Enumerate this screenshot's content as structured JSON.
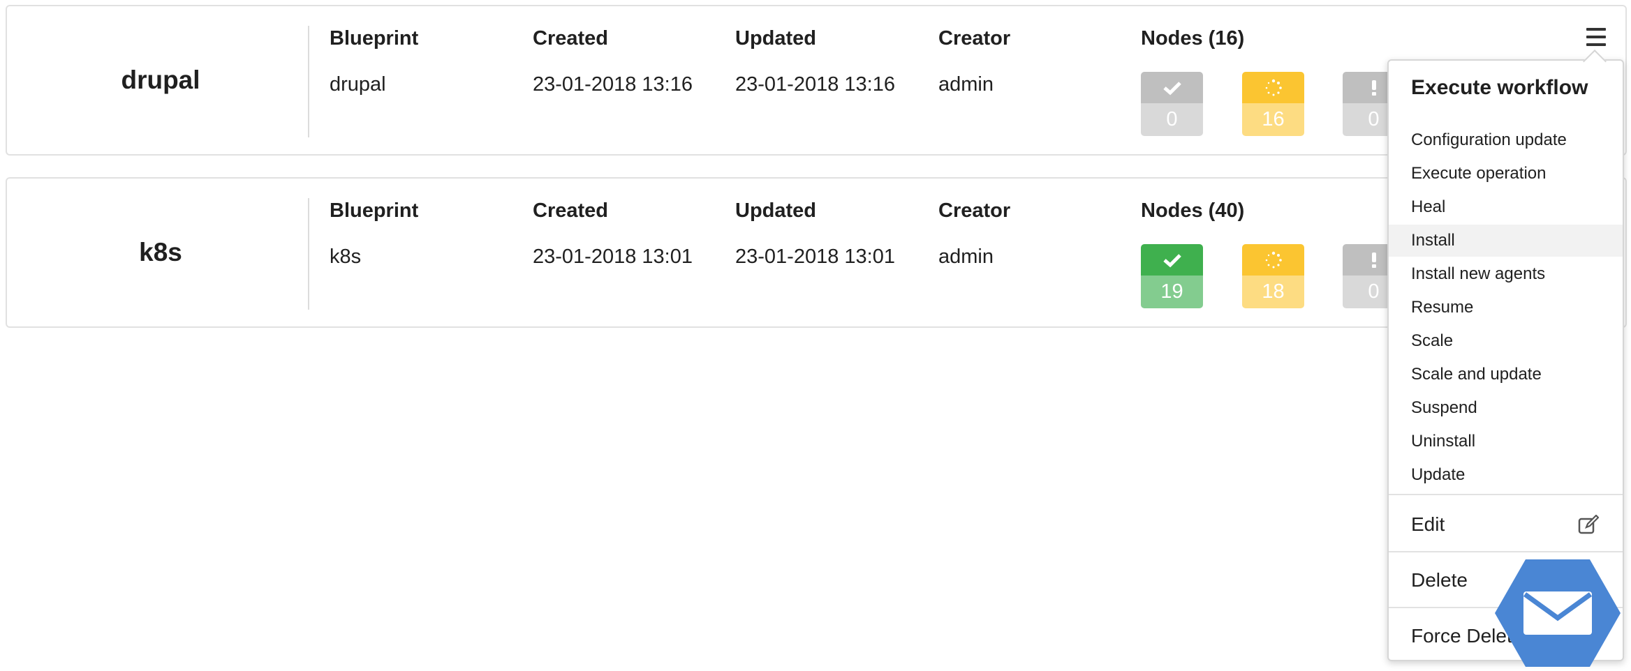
{
  "deployments": [
    {
      "name": "drupal",
      "headers": {
        "blueprint": "Blueprint",
        "created": "Created",
        "updated": "Updated",
        "creator": "Creator",
        "nodes": "Nodes (16)"
      },
      "blueprint": "drupal",
      "created": "23-01-2018 13:16",
      "updated": "23-01-2018 13:16",
      "creator": "admin",
      "node_counts": {
        "ok": "0",
        "in_progress": "16",
        "error": "0"
      }
    },
    {
      "name": "k8s",
      "headers": {
        "blueprint": "Blueprint",
        "created": "Created",
        "updated": "Updated",
        "creator": "Creator",
        "nodes": "Nodes (40)"
      },
      "blueprint": "k8s",
      "created": "23-01-2018 13:01",
      "updated": "23-01-2018 13:01",
      "creator": "admin",
      "node_counts": {
        "ok": "19",
        "in_progress": "18",
        "error": "0"
      }
    }
  ],
  "menu": {
    "header": "Execute workflow",
    "workflows": [
      "Configuration update",
      "Execute operation",
      "Heal",
      "Install",
      "Install new agents",
      "Resume",
      "Scale",
      "Scale and update",
      "Suspend",
      "Uninstall",
      "Update"
    ],
    "highlighted": "Install",
    "edit_label": "Edit",
    "delete_label": "Delete",
    "force_delete_label": "Force Delete"
  },
  "icons": {
    "menu": "hamburger-menu-icon",
    "ok": "checkmark-icon",
    "in_progress": "spinner-icon",
    "error": "exclamation-icon",
    "edit": "edit-icon",
    "chat": "envelope-icon"
  },
  "colors": {
    "ok_active": "#3fb04e",
    "in_progress": "#fbc531",
    "inactive": "#bfbfbf",
    "chat_button": "#4a86d4"
  }
}
